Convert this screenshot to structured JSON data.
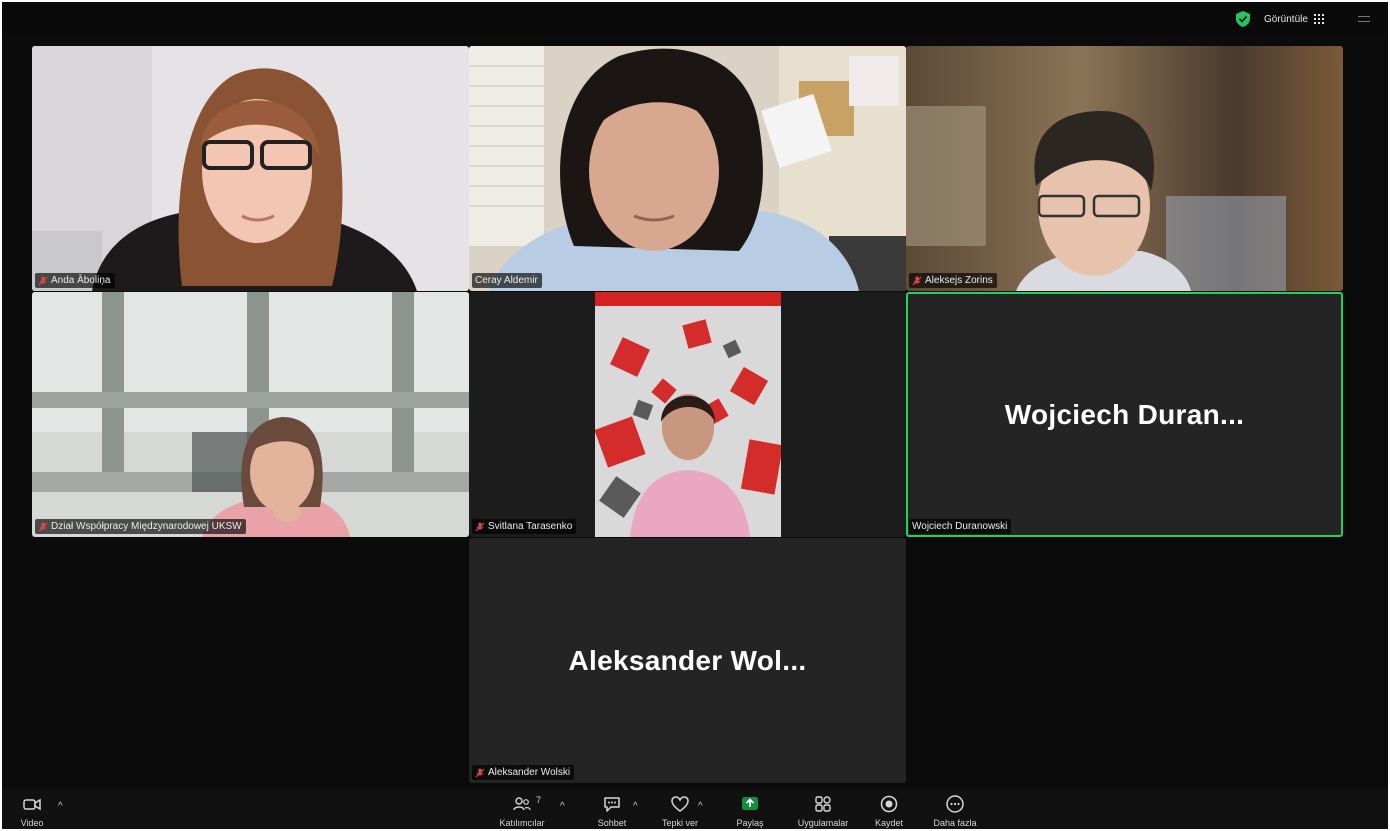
{
  "topbar": {
    "view_label": "Görüntüle",
    "shield_color": "#23c55e"
  },
  "participants": [
    {
      "name": "Anda Āboliņa",
      "video": true,
      "muted": true
    },
    {
      "name": "Ceray Aldemir",
      "video": true,
      "muted": false
    },
    {
      "name": "Aleksejs Zorins",
      "video": true,
      "muted": true
    },
    {
      "name": "Dział Współpracy Międzynarodowej UKSW",
      "video": true,
      "muted": true
    },
    {
      "name": "Svitlana Tarasenko",
      "video": true,
      "muted": true
    },
    {
      "name": "Wojciech Duranowski",
      "display_name": "Wojciech  Duran...",
      "video": false,
      "muted": false,
      "active_speaker": true
    },
    {
      "name": "Aleksander Wolski",
      "display_name": "Aleksander  Wol...",
      "video": false,
      "muted": true
    }
  ],
  "toolbar": {
    "video_label": "Video",
    "participants_label": "Katılımcılar",
    "participants_count": "7",
    "chat_label": "Sohbet",
    "react_label": "Tepki ver",
    "share_label": "Paylaş",
    "apps_label": "Uygulamalar",
    "record_label": "Kaydet",
    "more_label": "Daha fazla",
    "share_color": "#0e8f3e"
  }
}
